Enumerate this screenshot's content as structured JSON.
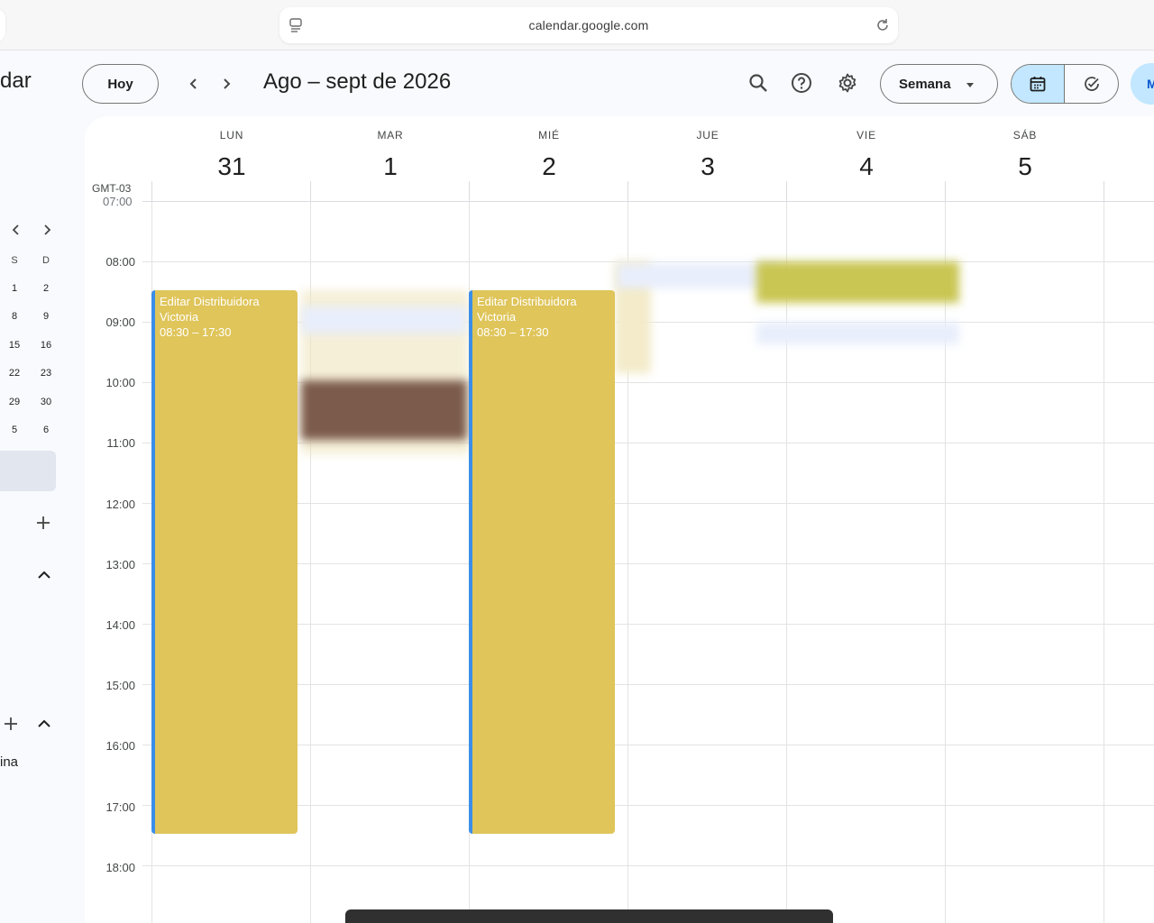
{
  "browser": {
    "url": "calendar.google.com"
  },
  "app": {
    "title_partial": "dar"
  },
  "header": {
    "today_label": "Hoy",
    "date_range": "Ago – sept de 2026",
    "view_label": "Semana",
    "avatar_initial": "M"
  },
  "mini_calendar": {
    "headers": [
      "S",
      "D"
    ],
    "rows": [
      [
        "1",
        "2"
      ],
      [
        "8",
        "9"
      ],
      [
        "15",
        "16"
      ],
      [
        "22",
        "23"
      ],
      [
        "29",
        "30"
      ],
      [
        "5",
        "6"
      ]
    ]
  },
  "sidebar": {
    "partial_text": "ina"
  },
  "calendar": {
    "timezone": "GMT-03",
    "partial_hour": "07:00",
    "days": [
      {
        "name": "LUN",
        "num": "31"
      },
      {
        "name": "MAR",
        "num": "1"
      },
      {
        "name": "MIÉ",
        "num": "2"
      },
      {
        "name": "JUE",
        "num": "3"
      },
      {
        "name": "VIE",
        "num": "4"
      },
      {
        "name": "SÁB",
        "num": "5"
      }
    ],
    "hours": [
      "08:00",
      "09:00",
      "10:00",
      "11:00",
      "12:00",
      "13:00",
      "14:00",
      "15:00",
      "16:00",
      "17:00",
      "18:00"
    ],
    "events": [
      {
        "title": "Editar Distribuidora Victoria",
        "time": "08:30 – 17:30"
      },
      {
        "title": "Editar Distribuidora Victoria",
        "time": "08:30 – 17:30"
      }
    ]
  },
  "colors": {
    "event_yellow": "#dfc55a",
    "event_border": "#3b8ee8",
    "accent": "#c2e7ff"
  }
}
